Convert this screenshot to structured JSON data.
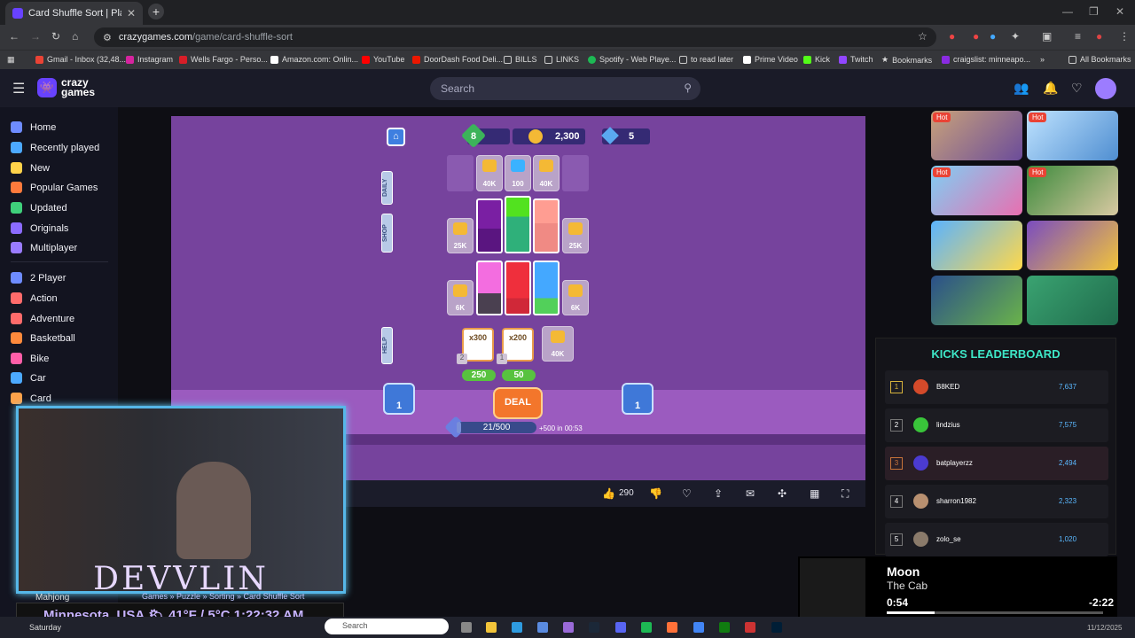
{
  "browser": {
    "tab_title": "Card Shuffle Sort | Play on C",
    "url_host": "crazygames.com",
    "url_path": "/game/card-shuffle-sort",
    "bookmarks": [
      "Gmail - Inbox (32,48...",
      "Instagram",
      "Wells Fargo - Perso...",
      "Amazon.com: Onlin...",
      "YouTube",
      "DoorDash Food Deli...",
      "BILLS",
      "LINKS",
      "Spotify - Web Playe...",
      "to read later",
      "Prime Video",
      "Kick",
      "Twitch",
      "Bookmarks",
      "craigslist: minneapo..."
    ],
    "all_bookmarks": "All Bookmarks",
    "bookmark_more": "»"
  },
  "site": {
    "logo_top": "crazy",
    "logo_bottom": "games",
    "search_placeholder": "Search"
  },
  "sidebar": {
    "items": [
      "Home",
      "Recently played",
      "New",
      "Popular Games",
      "Updated",
      "Originals",
      "Multiplayer",
      "2 Player",
      "Action",
      "Adventure",
      "Basketball",
      "Bike",
      "Car",
      "Card"
    ],
    "colors": [
      "#6e8cff",
      "#4ca9ff",
      "#ffd24a",
      "#ff7a3c",
      "#3fd07b",
      "#8b6bff",
      "#9a7cff",
      "#6e8cff",
      "#ff6b6b",
      "#ff6b6b",
      "#ff8a3c",
      "#ff5ea8",
      "#4ca9ff",
      "#ffa24a"
    ]
  },
  "game": {
    "level": "8",
    "coins": "2,300",
    "gems": "5",
    "top_locks": [
      "40K",
      "100",
      "40K"
    ],
    "row1_locks": [
      "25K",
      "25K"
    ],
    "row2_locks": [
      "6K",
      "6K"
    ],
    "mult1": "x300",
    "mult2": "x200",
    "mult_lock": "40K",
    "badge1": "2",
    "badge2": "1",
    "cost1": "250",
    "cost2": "50",
    "deal": "DEAL",
    "power_left": "1",
    "power_right": "1",
    "progress": "21/500",
    "progress_fraction": 0.042,
    "timer": "+500 in 00:53",
    "side_daily": "DAILY",
    "side_shop": "SHOP",
    "side_help": "HELP"
  },
  "toolbar": {
    "likes": "290"
  },
  "hot_label": "Hot",
  "leaderboard": {
    "title": "KICKS LEADERBOARD",
    "rows": [
      {
        "rank": "1",
        "name": "B8KED",
        "score": "7,637"
      },
      {
        "rank": "2",
        "name": "lindzius",
        "score": "7,575"
      },
      {
        "rank": "3",
        "name": "batplayerzz",
        "score": "2,494"
      },
      {
        "rank": "4",
        "name": "sharron1982",
        "score": "2,323"
      },
      {
        "rank": "5",
        "name": "zolo_se",
        "score": "1,020"
      }
    ]
  },
  "stream": {
    "brand": "DEVVLIN",
    "breadcrumb": "Games » Puzzle » Sorting » Card Shuffle Sort",
    "mahjong": "Mahjong",
    "weather": "Minnesota, USA 🌥 41°F / 5°C 1:22:32 AM"
  },
  "music": {
    "title": "Moon",
    "artist": "The Cab",
    "elapsed": "0:54",
    "remaining": "-2:22",
    "progress_fraction": 0.22
  },
  "taskbar": {
    "search": "Search",
    "day": "Saturday",
    "date": "11/12/2025"
  }
}
